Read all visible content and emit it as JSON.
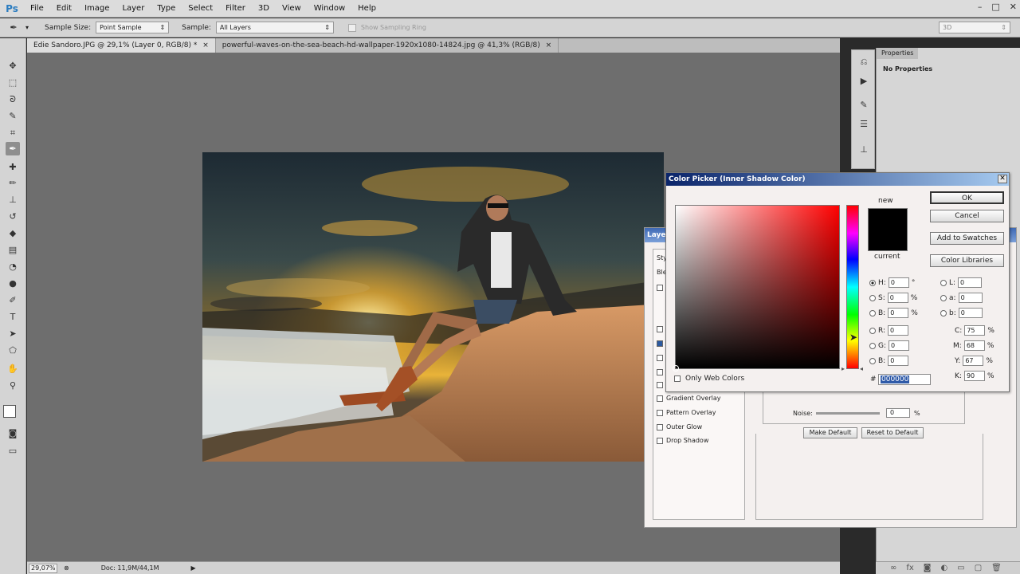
{
  "app": {
    "logo": "Ps",
    "menu": [
      "File",
      "Edit",
      "Image",
      "Layer",
      "Type",
      "Select",
      "Filter",
      "3D",
      "View",
      "Window",
      "Help"
    ],
    "window_controls": [
      "–",
      "□",
      "✕"
    ]
  },
  "options": {
    "sample_size_label": "Sample Size:",
    "sample_size_value": "Point Sample",
    "sample_label": "Sample:",
    "sample_value": "All Layers",
    "show_ring_label": "Show Sampling Ring",
    "workspace_value": "3D"
  },
  "tabs": [
    {
      "label": "Edie Sandoro.JPG @ 29,1% (Layer 0, RGB/8) *",
      "close": "×",
      "active": true
    },
    {
      "label": "powerful-waves-on-the-sea-beach-hd-wallpaper-1920x1080-14824.jpg @ 41,3% (RGB/8)",
      "close": "×",
      "active": false
    }
  ],
  "status": {
    "zoom": "29,07%",
    "doc": "Doc: 11,9M/44,1M"
  },
  "properties": {
    "tab": "Properties",
    "body": "No Properties"
  },
  "layer_style": {
    "title": "Layer Style",
    "visible_title": "Layer",
    "list_header_1": "Sty",
    "list_header_2": "Ble",
    "items": [
      {
        "label": "Gradient Overlay",
        "checked": false
      },
      {
        "label": "Pattern Overlay",
        "checked": false
      },
      {
        "label": "Outer Glow",
        "checked": false
      },
      {
        "label": "Drop Shadow",
        "checked": false
      }
    ],
    "noise_label": "Noise:",
    "noise_value": "0",
    "noise_unit": "%",
    "make_default": "Make Default",
    "reset_default": "Reset to Default"
  },
  "color_picker": {
    "title": "Color Picker (Inner Shadow Color)",
    "close": "✕",
    "new_label": "new",
    "current_label": "current",
    "ok": "OK",
    "cancel": "Cancel",
    "add_to_swatches": "Add to Swatches",
    "color_libraries": "Color Libraries",
    "only_web_colors": "Only Web Colors",
    "hex_label": "#",
    "hex_value": "000000",
    "hsb": [
      {
        "label": "H:",
        "value": "0",
        "unit": "°",
        "selected": true
      },
      {
        "label": "S:",
        "value": "0",
        "unit": "%",
        "selected": false
      },
      {
        "label": "B:",
        "value": "0",
        "unit": "%",
        "selected": false
      }
    ],
    "rgb": [
      {
        "label": "R:",
        "value": "0"
      },
      {
        "label": "G:",
        "value": "0"
      },
      {
        "label": "B:",
        "value": "0"
      }
    ],
    "lab": [
      {
        "label": "L:",
        "value": "0"
      },
      {
        "label": "a:",
        "value": "0"
      },
      {
        "label": "b:",
        "value": "0"
      }
    ],
    "cmyk": [
      {
        "label": "C:",
        "value": "75",
        "unit": "%"
      },
      {
        "label": "M:",
        "value": "68",
        "unit": "%"
      },
      {
        "label": "Y:",
        "value": "67",
        "unit": "%"
      },
      {
        "label": "K:",
        "value": "90",
        "unit": "%"
      }
    ],
    "new_color": "#000000"
  },
  "icons": {
    "tools": [
      "move-icon",
      "marquee-icon",
      "lasso-icon",
      "quick-select-icon",
      "crop-icon",
      "eyedropper-icon",
      "spot-heal-icon",
      "brush-icon",
      "stamp-icon",
      "history-brush-icon",
      "eraser-icon",
      "gradient-icon",
      "blur-icon",
      "dodge-icon",
      "pen-icon",
      "type-icon",
      "path-select-icon",
      "shape-icon",
      "hand-icon",
      "zoom-icon"
    ]
  }
}
